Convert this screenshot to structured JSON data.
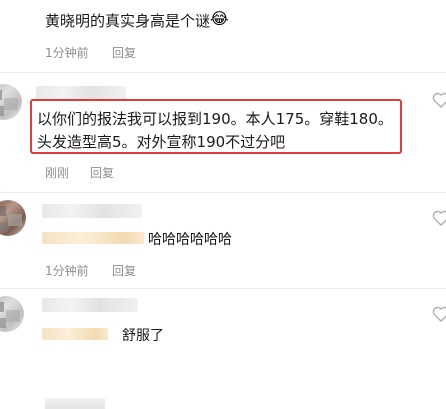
{
  "comments": [
    {
      "text": "黄晓明的真实身高是个谜",
      "emoji": "😂",
      "time": "1分钟前",
      "reply_label": "回复"
    },
    {
      "text_line1": "以你们的报法我可以报到190。本人175。穿鞋180。",
      "text_line2": "头发造型高5。对外宣称190不过分吧",
      "time": "刚刚",
      "reply_label": "回复"
    },
    {
      "text": "哈哈哈哈哈哈",
      "time": "1分钟前",
      "reply_label": "回复"
    },
    {
      "text": "舒服了"
    }
  ],
  "icons": {
    "like": "heart-icon",
    "highlight_color": "#e23b3b"
  }
}
